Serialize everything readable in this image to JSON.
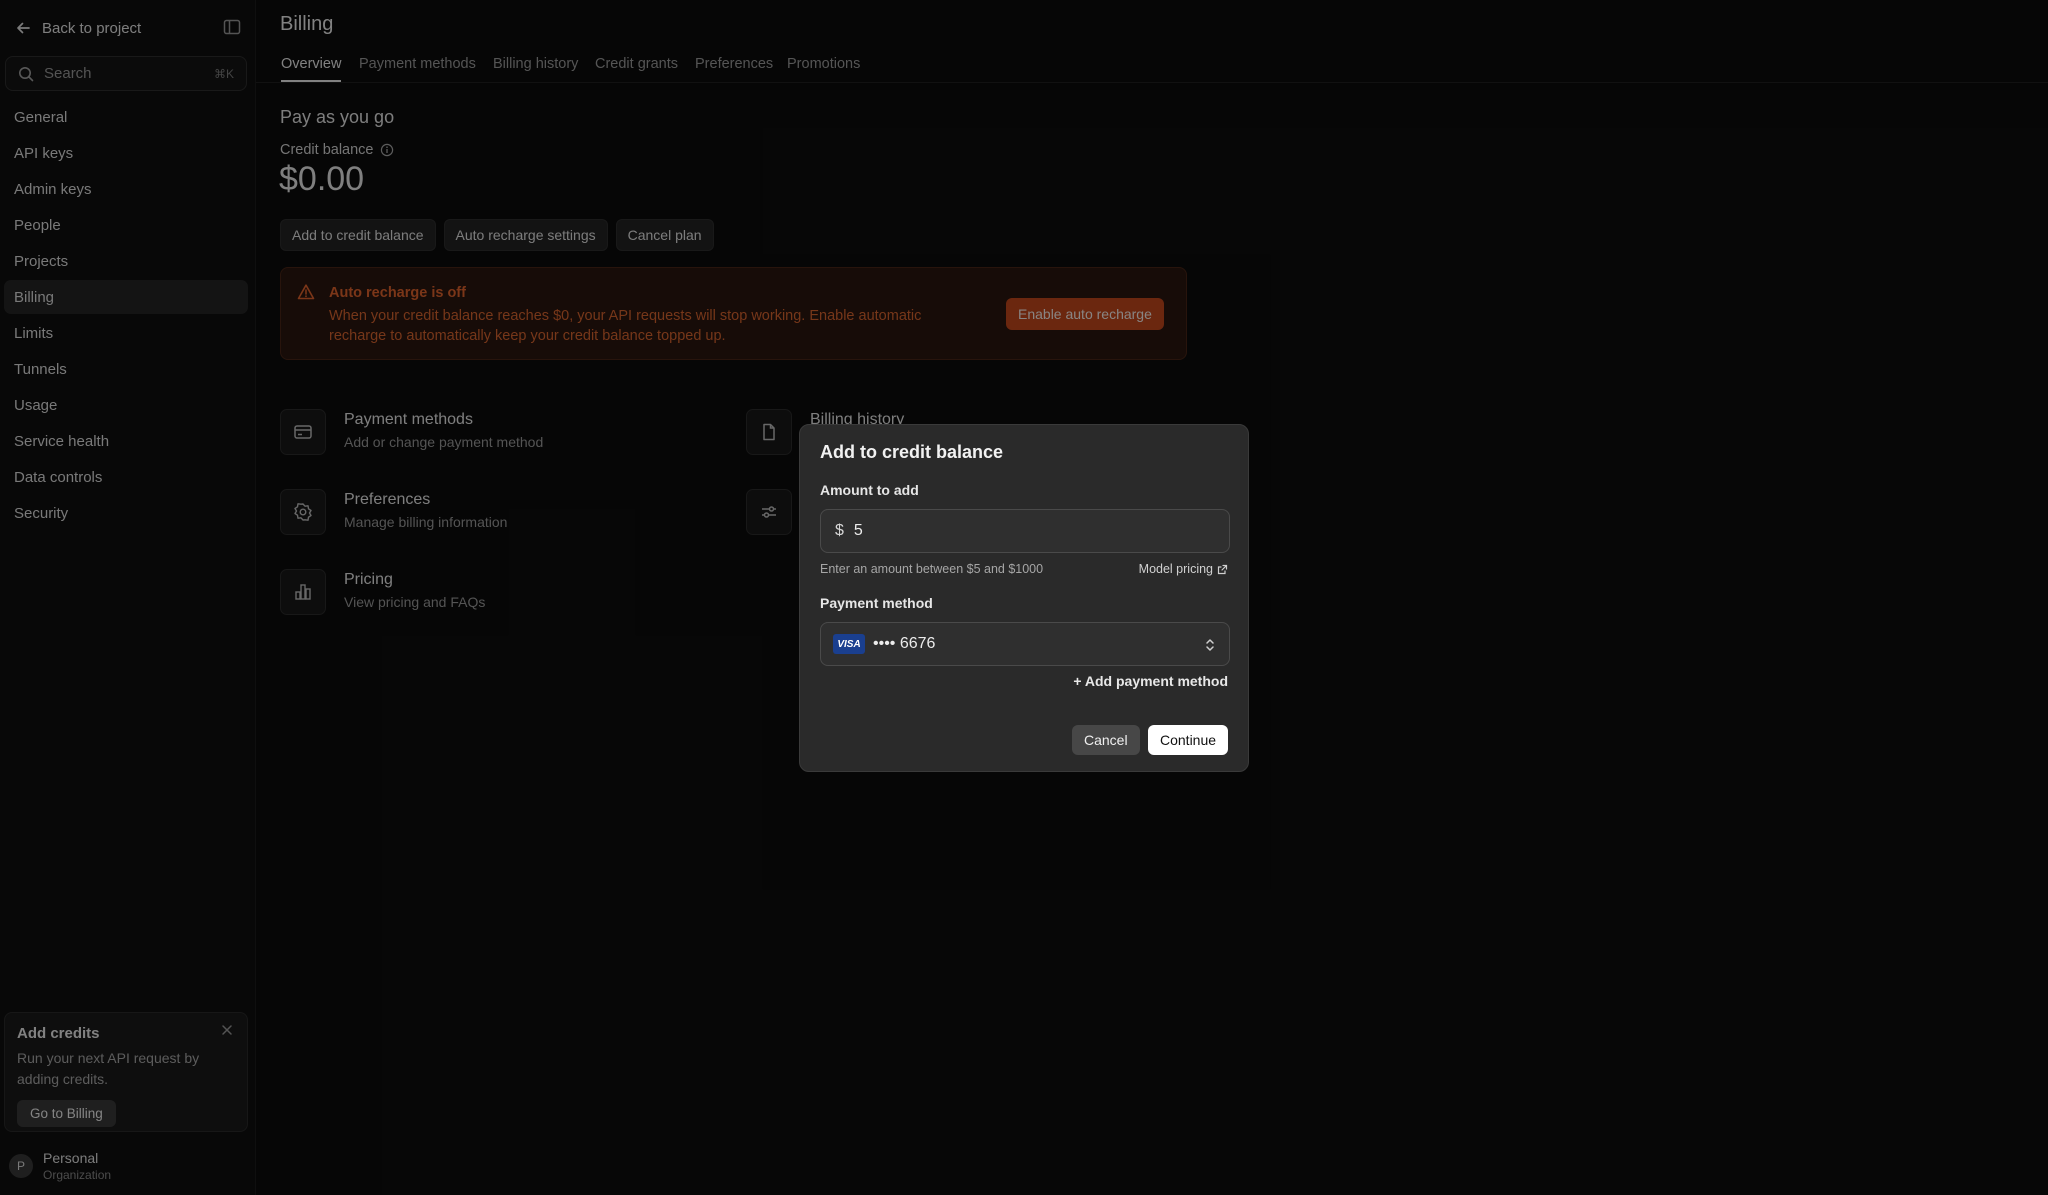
{
  "sidebar": {
    "back_label": "Back to project",
    "search_placeholder": "Search",
    "search_shortcut": "⌘K",
    "items": [
      {
        "label": "General"
      },
      {
        "label": "API keys"
      },
      {
        "label": "Admin keys"
      },
      {
        "label": "People"
      },
      {
        "label": "Projects"
      },
      {
        "label": "Billing",
        "active": true
      },
      {
        "label": "Limits"
      },
      {
        "label": "Tunnels"
      },
      {
        "label": "Usage"
      },
      {
        "label": "Service health"
      },
      {
        "label": "Data controls"
      },
      {
        "label": "Security"
      }
    ],
    "promo": {
      "title": "Add credits",
      "text": "Run your next API request by adding credits.",
      "button": "Go to Billing"
    },
    "org": {
      "initial": "P",
      "name": "Personal",
      "sub": "Organization"
    }
  },
  "main": {
    "title": "Billing",
    "tabs": [
      {
        "label": "Overview",
        "active": true
      },
      {
        "label": "Payment methods"
      },
      {
        "label": "Billing history"
      },
      {
        "label": "Credit grants"
      },
      {
        "label": "Preferences"
      },
      {
        "label": "Promotions"
      }
    ],
    "plan_title": "Pay as you go",
    "credit_label": "Credit balance",
    "credit_amount": "$0.00",
    "actions": {
      "add": "Add to credit balance",
      "auto": "Auto recharge settings",
      "cancel": "Cancel plan"
    },
    "alert": {
      "title": "Auto recharge is off",
      "text": "When your credit balance reaches $0, your API requests will stop working. Enable automatic recharge to automatically keep your credit balance topped up.",
      "button": "Enable auto recharge",
      "color": "#e0632c"
    },
    "cards": [
      {
        "title": "Payment methods",
        "sub": "Add or change payment method",
        "icon": "credit-card-icon"
      },
      {
        "title": "Billing history",
        "sub": "",
        "icon": "file-icon"
      },
      {
        "title": "Preferences",
        "sub": "Manage billing information",
        "icon": "gear-icon"
      },
      {
        "title": "",
        "sub": "",
        "icon": "sliders-icon"
      },
      {
        "title": "Pricing",
        "sub": "View pricing and FAQs",
        "icon": "bar-chart-icon"
      }
    ]
  },
  "modal": {
    "title": "Add to credit balance",
    "amount_label": "Amount to add",
    "currency": "$",
    "amount_value": "5",
    "hint": "Enter an amount between $5 and $1000",
    "model_pricing": "Model pricing",
    "payment_label": "Payment method",
    "card_brand": "VISA",
    "card_number": "•••• 6676",
    "add_payment": "+ Add payment method",
    "cancel": "Cancel",
    "continue": "Continue"
  }
}
